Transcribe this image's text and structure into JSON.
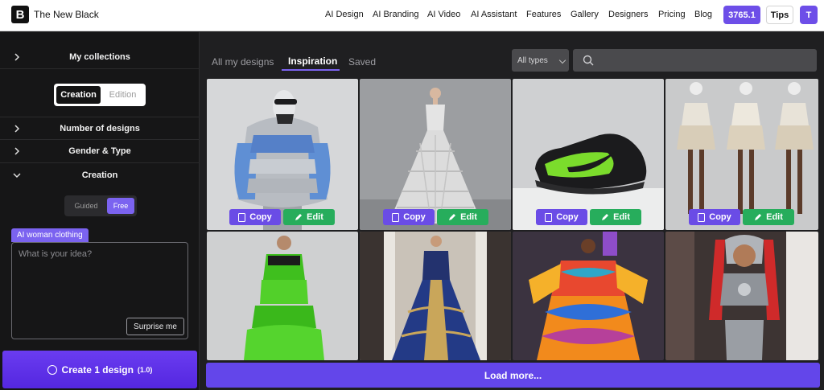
{
  "header": {
    "logo_letter": "B",
    "brand": "The New Black",
    "nav": [
      "AI Design",
      "AI Branding",
      "AI Video",
      "AI Assistant",
      "Features",
      "Gallery",
      "Designers",
      "Pricing",
      "Blog"
    ],
    "credits": "3765.1",
    "tips": "Tips",
    "avatar_initial": "T"
  },
  "sidebar": {
    "collections": "My collections",
    "mode": {
      "active": "Creation",
      "inactive": "Edition"
    },
    "sections": [
      "Number of designs",
      "Gender & Type",
      "Creation"
    ],
    "creation_mode": {
      "inactive": "Guided",
      "active": "Free"
    },
    "prompt_tag": "AI woman clothing",
    "prompt_placeholder": "What is your idea?",
    "surprise": "Surprise me",
    "create": {
      "label": "Create 1 design",
      "cost": "(1.0)"
    }
  },
  "main": {
    "tabs": [
      "All my designs",
      "Inspiration",
      "Saved"
    ],
    "active_tab": "Inspiration",
    "type_filter": "All types",
    "copy_label": "Copy",
    "edit_label": "Edit",
    "load_more": "Load more...",
    "gallery": [
      "puffer-jacket-masked-model",
      "white-lace-gown",
      "black-green-sneaker",
      "white-gold-ruffled-outfits",
      "green-puffer-coat",
      "blue-gold-runway-gown",
      "colorful-swirl-dress",
      "silver-armor-runway-look"
    ]
  },
  "colors": {
    "accent": "#6d4ee8",
    "edit_green": "#27ad5c",
    "sidebar_bg": "#161617",
    "main_bg": "#1f1f21"
  }
}
